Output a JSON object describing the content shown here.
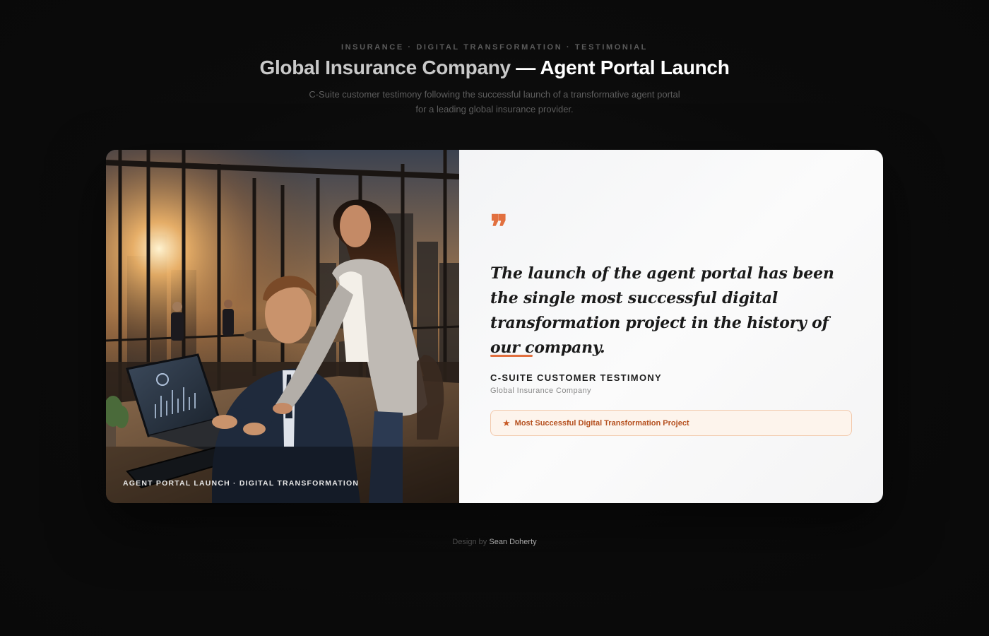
{
  "header": {
    "eyebrow": "INSURANCE · DIGITAL TRANSFORMATION · TESTIMONIAL",
    "title_part1": "Global Insurance Company",
    "title_part2": " — Agent Portal Launch",
    "subtitle": "C-Suite customer testimony following the successful launch of a transformative agent portal for a leading global insurance provider."
  },
  "card": {
    "photo_caption": "AGENT PORTAL LAUNCH · DIGITAL TRANSFORMATION",
    "quote_mark": "❞",
    "quote": "The launch of the agent portal has been the single most successful digital transformation project in the history of our company.",
    "author_role": "C-SUITE CUSTOMER TESTIMONY",
    "author_company": "Global Insurance Company",
    "badge_icon": "star-icon",
    "badge_star": "★",
    "badge_text": "Most Successful Digital Transformation Project"
  },
  "footer": {
    "prefix": "Design by ",
    "author": "Sean Doherty"
  },
  "colors": {
    "accent": "#e2703f",
    "background": "#0a0a0a",
    "panel": "#f7f7f8"
  }
}
